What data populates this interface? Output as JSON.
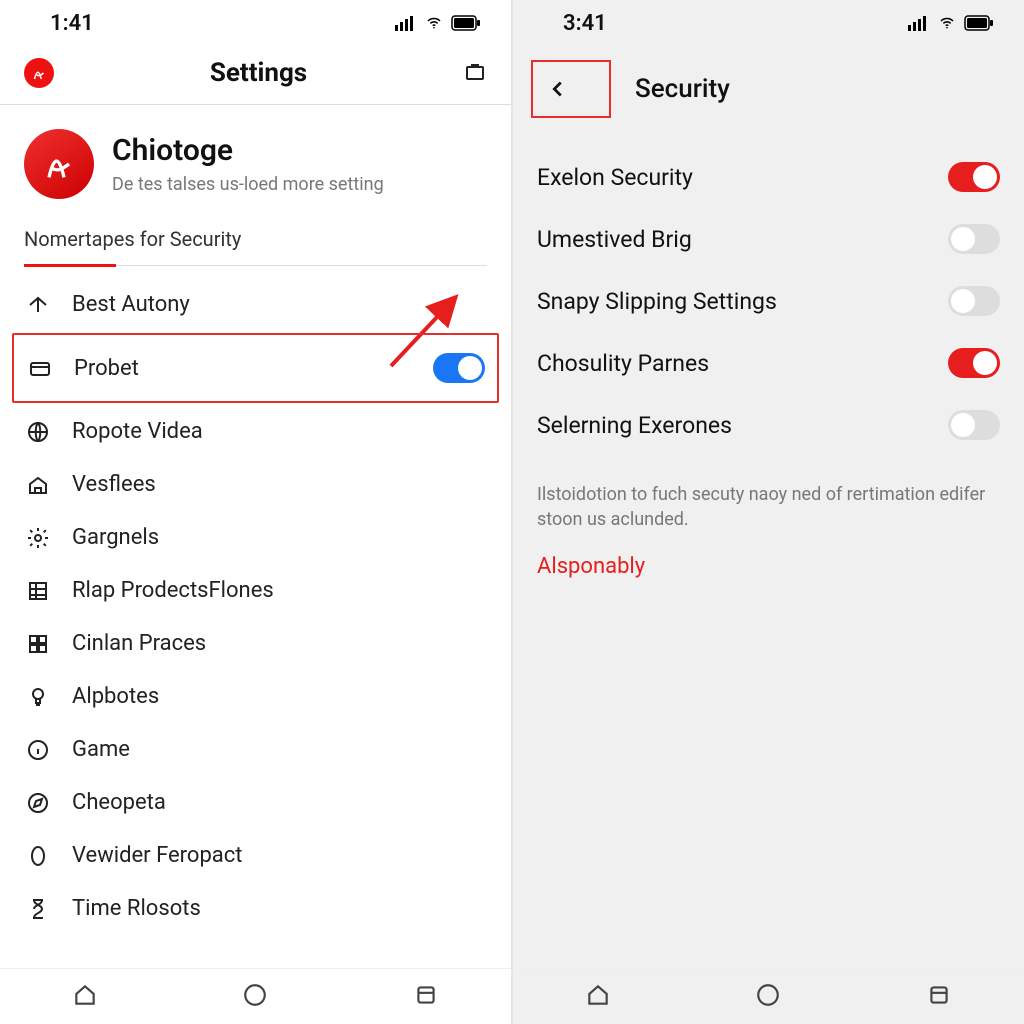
{
  "left": {
    "status": {
      "time": "1:41"
    },
    "header": {
      "title": "Settings"
    },
    "profile": {
      "name": "Chiotoge",
      "subtitle": "De tes talses us-loed more setting"
    },
    "section_label": "Nomertapes for Security",
    "items": [
      {
        "label": "Best Autony"
      },
      {
        "label": "Probet",
        "toggle": true
      },
      {
        "label": "Ropote Videa"
      },
      {
        "label": "Vesflees"
      },
      {
        "label": "Gargnels"
      },
      {
        "label": "Rlap ProdectsFlones"
      },
      {
        "label": "Cinlan Praces"
      },
      {
        "label": "Alpbotes"
      },
      {
        "label": "Game"
      },
      {
        "label": "Cheopeta"
      },
      {
        "label": "Vewider Feropact"
      },
      {
        "label": "Time Rlosots"
      }
    ]
  },
  "right": {
    "status": {
      "time": "3:41"
    },
    "header": {
      "title": "Security"
    },
    "items": [
      {
        "label": "Exelon Security",
        "on": true
      },
      {
        "label": "Umestived Brig",
        "on": false
      },
      {
        "label": "Snapy Slipping Settings",
        "on": false
      },
      {
        "label": "Chosulity Parnes",
        "on": true
      },
      {
        "label": "Selerning Exerones",
        "on": false
      }
    ],
    "info": "Ilstoidotion to fuch secuty naoy ned of rertimation edifer stoon us aclunded.",
    "link": "Alsponably"
  },
  "colors": {
    "accent_red": "#e61e1e",
    "accent_blue": "#1976f5"
  }
}
